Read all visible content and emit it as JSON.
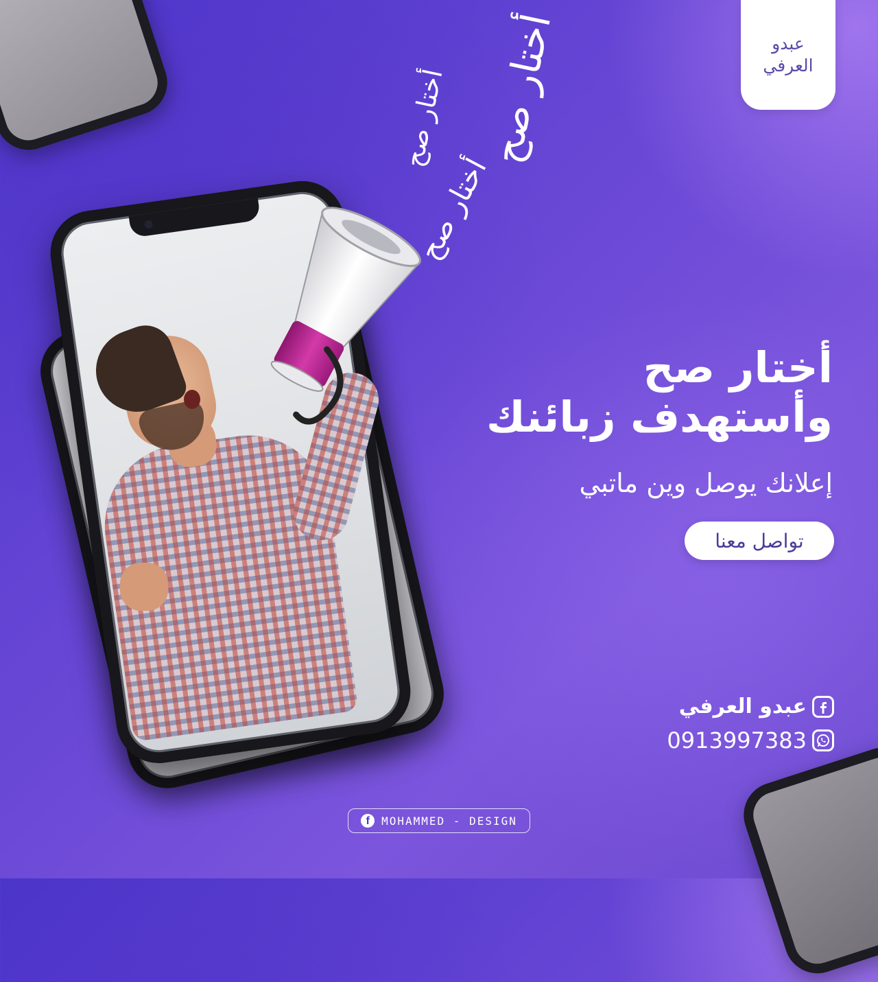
{
  "brand_tag": {
    "line1": "عبدو",
    "line2": "العرفي"
  },
  "slogan_burst": [
    "أختار صح",
    "أختار صح",
    "أختار صح"
  ],
  "headline": {
    "line1": "أختار صح",
    "line2": "وأستهدف زبائنك"
  },
  "subline": "إعلانك يوصل وين ماتبي",
  "cta": {
    "label": "تواصل معنا"
  },
  "contact": {
    "facebook_name": "عبدو العرفي",
    "phone": "0913997383",
    "facebook_icon": "facebook-icon",
    "whatsapp_icon": "whatsapp-icon"
  },
  "credit": {
    "text": "MOHAMMED - DESIGN",
    "icon": "facebook-icon"
  },
  "colors": {
    "background_primary": "#5a3fd0",
    "background_accent": "#8a5ee0",
    "megaphone_band": "#c0279a",
    "text": "#ffffff",
    "cta_text": "#4a3a9a"
  }
}
